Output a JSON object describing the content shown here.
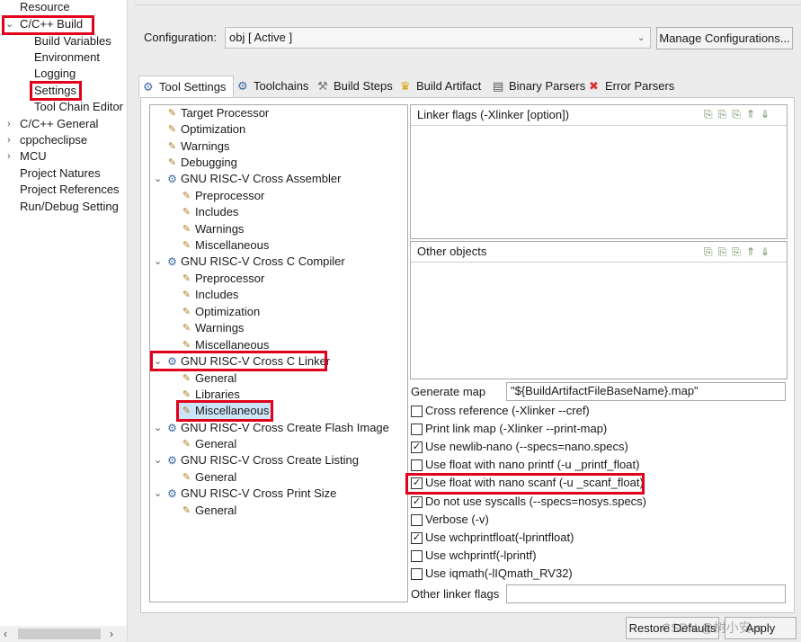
{
  "nav": {
    "items": [
      {
        "label": "Resource"
      },
      {
        "label": "C/C++ Build"
      },
      {
        "label": "Build Variables"
      },
      {
        "label": "Environment"
      },
      {
        "label": "Logging"
      },
      {
        "label": "Settings"
      },
      {
        "label": "Tool Chain Editor"
      },
      {
        "label": "C/C++ General"
      },
      {
        "label": "cppcheclipse"
      },
      {
        "label": "MCU"
      },
      {
        "label": "Project Natures"
      },
      {
        "label": "Project References"
      },
      {
        "label": "Run/Debug Setting"
      }
    ]
  },
  "config": {
    "label": "Configuration:",
    "value": "obj  [ Active ]",
    "manage_button": "Manage Configurations..."
  },
  "tabs": [
    {
      "label": "Tool Settings",
      "icon": "tool-settings-icon"
    },
    {
      "label": "Toolchains",
      "icon": "toolchains-icon"
    },
    {
      "label": "Build Steps",
      "icon": "build-steps-icon"
    },
    {
      "label": "Build Artifact",
      "icon": "trophy-icon"
    },
    {
      "label": "Binary Parsers",
      "icon": "binary-parsers-icon"
    },
    {
      "label": "Error Parsers",
      "icon": "error-icon"
    }
  ],
  "tree": {
    "items": [
      {
        "label": "Target Processor"
      },
      {
        "label": "Optimization"
      },
      {
        "label": "Warnings"
      },
      {
        "label": "Debugging"
      },
      {
        "label": "GNU RISC-V Cross Assembler"
      },
      {
        "label": "Preprocessor"
      },
      {
        "label": "Includes"
      },
      {
        "label": "Warnings"
      },
      {
        "label": "Miscellaneous"
      },
      {
        "label": "GNU RISC-V Cross C Compiler"
      },
      {
        "label": "Preprocessor"
      },
      {
        "label": "Includes"
      },
      {
        "label": "Optimization"
      },
      {
        "label": "Warnings"
      },
      {
        "label": "Miscellaneous"
      },
      {
        "label": "GNU RISC-V Cross C Linker"
      },
      {
        "label": "General"
      },
      {
        "label": "Libraries"
      },
      {
        "label": "Miscellaneous"
      },
      {
        "label": "GNU RISC-V Cross Create Flash Image"
      },
      {
        "label": "General"
      },
      {
        "label": "GNU RISC-V Cross Create Listing"
      },
      {
        "label": "General"
      },
      {
        "label": "GNU RISC-V Cross Print Size"
      },
      {
        "label": "General"
      }
    ]
  },
  "linker_flags": {
    "title": "Linker flags (-Xlinker [option])"
  },
  "other_objects": {
    "title": "Other objects"
  },
  "generate_map": {
    "label": "Generate map",
    "value": "\"${BuildArtifactFileBaseName}.map\""
  },
  "options": [
    {
      "label": "Cross reference (-Xlinker --cref)",
      "checked": false
    },
    {
      "label": "Print link map (-Xlinker --print-map)",
      "checked": false
    },
    {
      "label": "Use newlib-nano (--specs=nano.specs)",
      "checked": true
    },
    {
      "label": "Use float with nano printf (-u _printf_float)",
      "checked": false
    },
    {
      "label": "Use float with nano scanf (-u _scanf_float)",
      "checked": true
    },
    {
      "label": "Do not use syscalls (--specs=nosys.specs)",
      "checked": true
    },
    {
      "label": "Verbose (-v)",
      "checked": false
    },
    {
      "label": "Use wchprintfloat(-lprintfloat)",
      "checked": true
    },
    {
      "label": "Use wchprintf(-lprintf)",
      "checked": false
    },
    {
      "label": "Use iqmath(-lIQmath_RV32)",
      "checked": false
    }
  ],
  "other_linker_flags": {
    "label": "Other linker flags",
    "value": ""
  },
  "buttons": {
    "restore": "Restore Defaults",
    "apply": "Apply"
  },
  "watermark": "CSDN @树小安-s",
  "highlight_color": "#e0001b"
}
